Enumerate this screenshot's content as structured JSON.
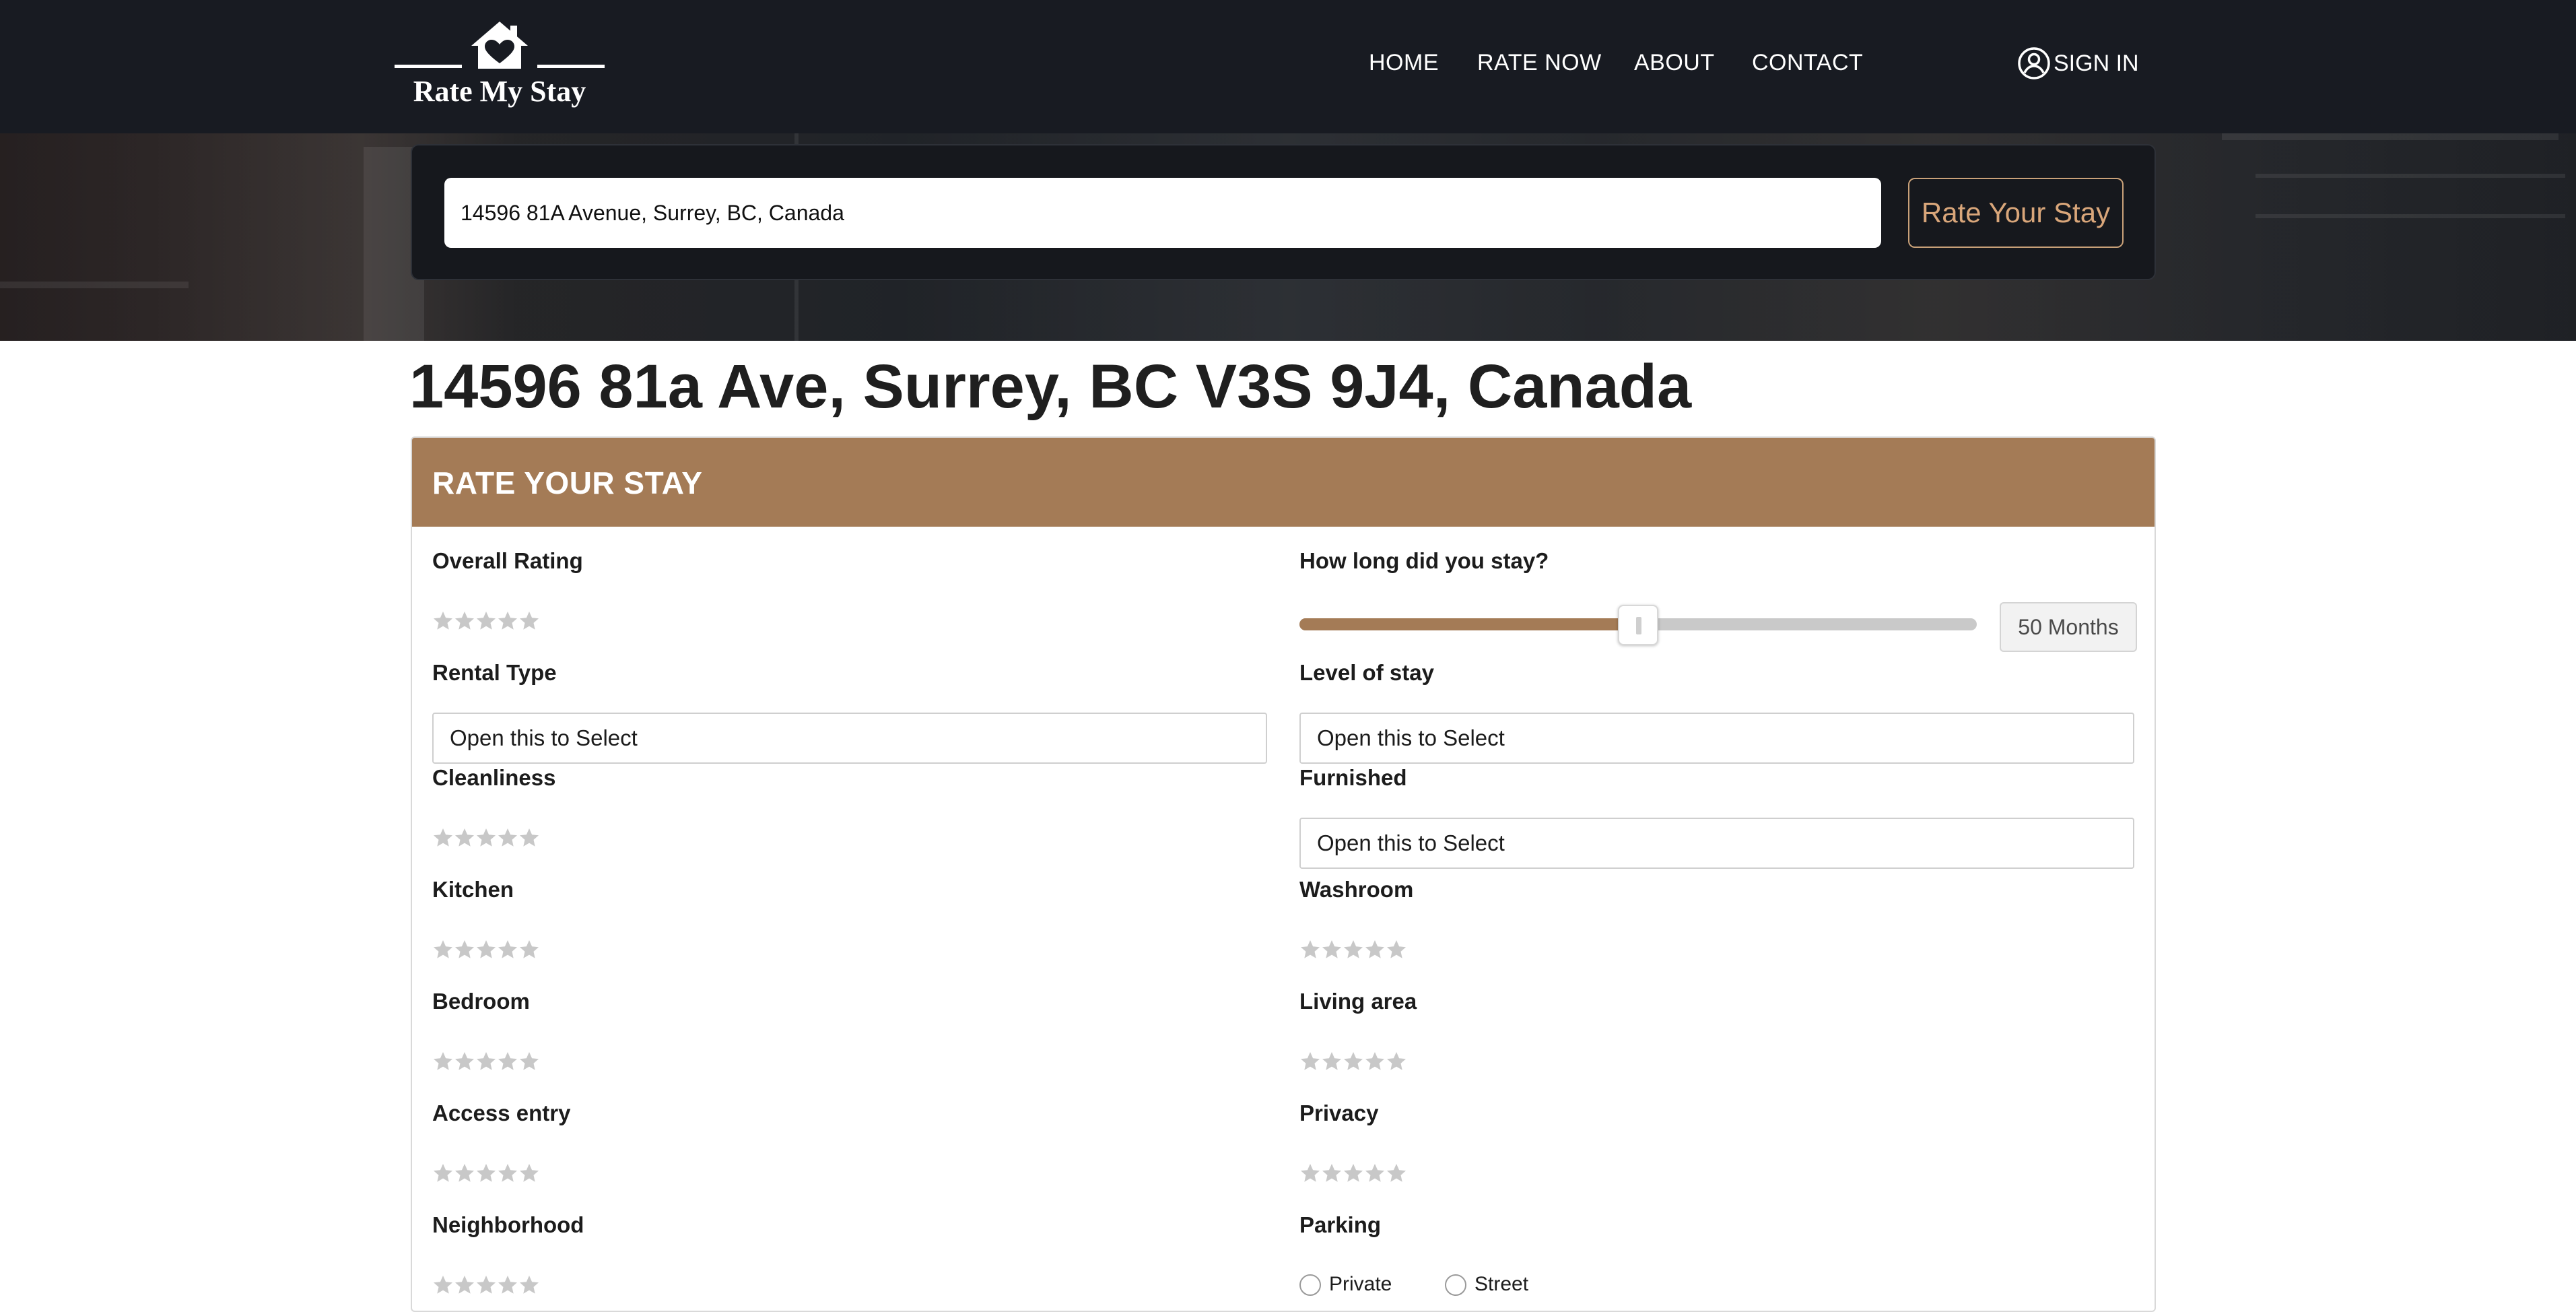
{
  "brand": {
    "name": "Rate My Stay"
  },
  "nav": {
    "home": "HOME",
    "rate_now": "RATE NOW",
    "about": "ABOUT",
    "contact": "CONTACT",
    "sign_in": "SIGN IN"
  },
  "search": {
    "value": "14596 81A Avenue, Surrey, BC, Canada",
    "button": "Rate Your Stay"
  },
  "address": "14596 81a Ave, Surrey, BC V3S 9J4, Canada",
  "form": {
    "title": "RATE YOUR STAY",
    "overall_rating": "Overall Rating",
    "stay_length_label": "How long did you stay?",
    "stay_length_months": 50,
    "stay_length_max": 100,
    "stay_length_display": "50 Months",
    "rental_type": "Rental Type",
    "level_of_stay": "Level of stay",
    "select_placeholder": "Open this to Select",
    "cleanliness": "Cleanliness",
    "furnished": "Furnished",
    "kitchen": "Kitchen",
    "washroom": "Washroom",
    "bedroom": "Bedroom",
    "living_area": "Living area",
    "access_entry": "Access entry",
    "privacy": "Privacy",
    "neighborhood": "Neighborhood",
    "parking": "Parking",
    "parking_options": [
      "Private",
      "Street"
    ]
  },
  "ratings": {
    "overall": 0,
    "cleanliness": 0,
    "kitchen": 0,
    "washroom": 0,
    "bedroom": 0,
    "living_area": 0,
    "access_entry": 0,
    "privacy": 0,
    "neighborhood": 0
  },
  "colors": {
    "navbar": "#181b22",
    "accent": "#a47b56",
    "button_text": "#d9a67a",
    "star_empty": "#c8c8c8"
  },
  "icons": {
    "logo": "house-heart-icon",
    "sign_in": "user-circle-icon",
    "star": "star-icon",
    "slider": "slider-thumb"
  }
}
